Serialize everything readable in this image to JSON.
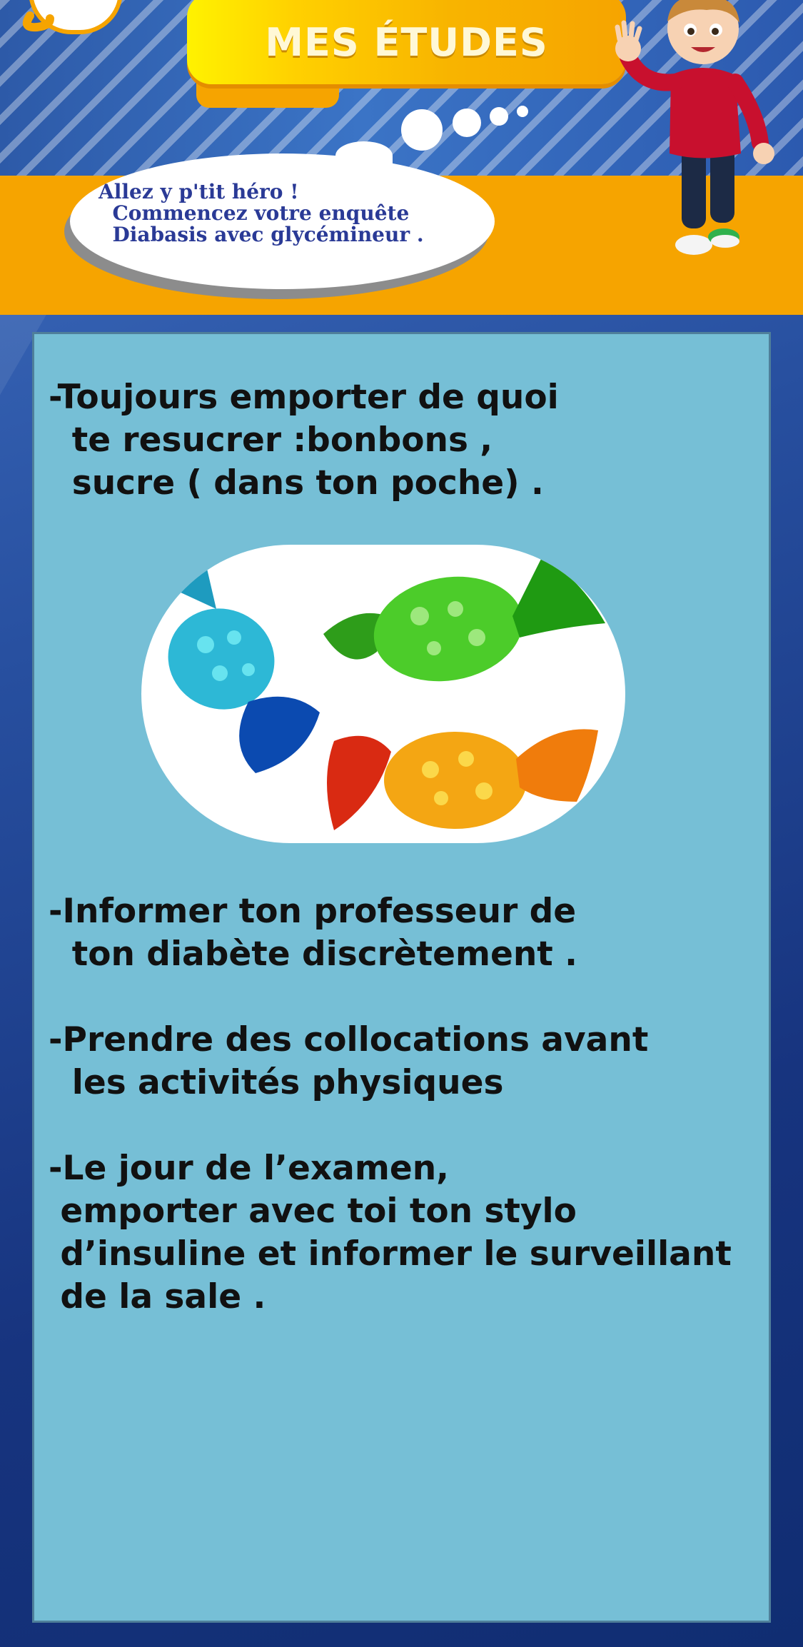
{
  "header": {
    "title": "MES ÉTUDES",
    "bubble_lines": [
      "Allez y p'tit héro !",
      "  Commencez votre enquête",
      "  Diabasis avec glycémineur ."
    ]
  },
  "content": {
    "tip1_lines": [
      "-Toujours emporter de quoi",
      "  te resucrer :bonbons ,",
      "  sucre ( dans ton poche) ."
    ],
    "tip2_lines": [
      "-Informer ton professeur de",
      "  ton diabète discrètement ."
    ],
    "tip3_lines": [
      "-Prendre des collocations avant",
      "  les activités physiques"
    ],
    "tip4_lines": [
      "-Le jour de l’examen,",
      " emporter avec toi ton stylo",
      " d’insuline et informer le surveillant",
      " de la sale ."
    ]
  },
  "colors": {
    "orange": "#f6a400",
    "panel": "#76bfd6",
    "navy_text": "#2a3a96",
    "background": "#1f3f8f"
  },
  "icons": [
    "logo-icon",
    "boy-character-illustration",
    "candy-blue-icon",
    "candy-green-icon",
    "candy-orange-icon"
  ]
}
